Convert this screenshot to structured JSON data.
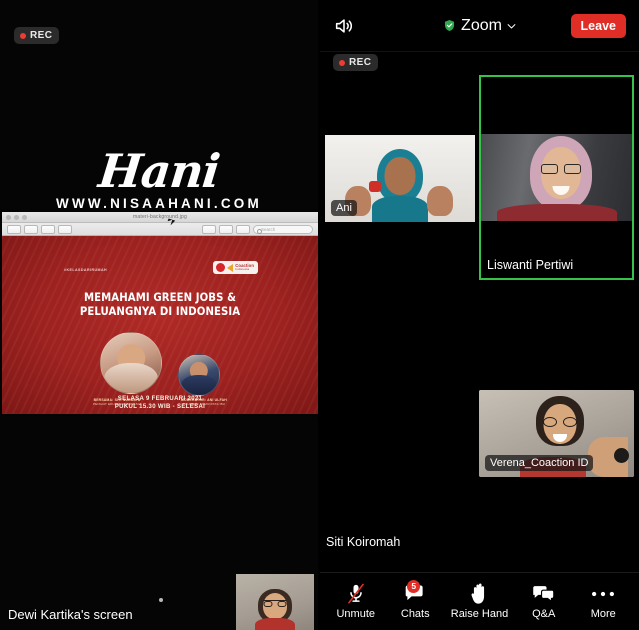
{
  "shared_screen": {
    "rec_badge": "REC",
    "brand": {
      "name": "Hani",
      "url": "WWW.NISAAHANI.COM"
    },
    "preview_window": {
      "title": "materi-background.jpg",
      "search_placeholder": "Search"
    },
    "slide": {
      "hashtag": "#KELASDARIRUMAH",
      "logo_name": "Coaction",
      "logo_sub": "Indonesia",
      "title_line1": "MEMAHAMI GREEN JOBS &",
      "title_line2": "PELUANGNYA DI INDONESIA",
      "credit_left_name": "BERSAMA: SITI NURBAYA",
      "credit_left_role": "PENGIAT EDUKASI INDONESIA",
      "credit_right_name": "MODERATOR: ANI ULFAH",
      "credit_right_role": "FOUNDER KOMUNITAS IBU",
      "footer_line1": "SELASA 9 FEBRUARI 2021",
      "footer_line2": "PUKUL 15.30 WIB - SELESAI"
    },
    "share_label": "Dewi Kartika's screen"
  },
  "zoom": {
    "header": {
      "title": "Zoom",
      "leave_label": "Leave",
      "speaker_icon": "speaker-icon",
      "shield_icon": "shield-check-icon",
      "chevron_icon": "chevron-down-icon"
    },
    "rec_badge": "REC",
    "participants": [
      {
        "name": "Ani",
        "active_speaker": false,
        "video_on": true
      },
      {
        "name": "Liswanti Pertiwi",
        "active_speaker": true,
        "video_on": true
      },
      {
        "name": "Verena_Coaction ID",
        "active_speaker": false,
        "video_on": true
      },
      {
        "name": "Siti Koiromah",
        "active_speaker": false,
        "video_on": false
      }
    ],
    "toolbar": [
      {
        "label": "Unmute",
        "icon": "microphone-muted-icon",
        "badge": ""
      },
      {
        "label": "Chats",
        "icon": "chat-bubble-icon",
        "badge": "5"
      },
      {
        "label": "Raise Hand",
        "icon": "raised-hand-icon",
        "badge": ""
      },
      {
        "label": "Q&A",
        "icon": "question-answer-icon",
        "badge": ""
      },
      {
        "label": "More",
        "icon": "ellipsis-icon",
        "badge": ""
      }
    ]
  },
  "colors": {
    "accent_red": "#e02d26",
    "active_speaker_green": "#35c449",
    "slide_red": "#9c211f",
    "badge_red": "#e02d26"
  }
}
